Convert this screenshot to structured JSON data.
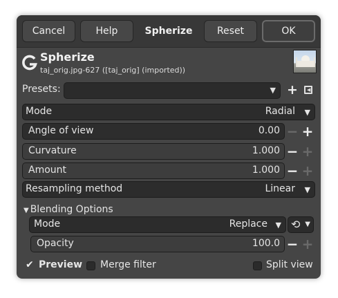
{
  "header": {
    "cancel_label": "Cancel",
    "help_label": "Help",
    "title": "Spherize",
    "reset_label": "Reset",
    "ok_label": "OK"
  },
  "plugin": {
    "logo_letter": "G",
    "title": "Spherize",
    "subtitle": "taj_orig.jpg-627 ([taj_orig] (imported))",
    "thumbnail_icon": "image-thumbnail"
  },
  "presets": {
    "label": "Presets:",
    "value": "",
    "add_icon": "plus-icon",
    "menu_icon": "menu-icon"
  },
  "mode": {
    "label": "Mode",
    "value": "Radial"
  },
  "angle_of_view": {
    "label": "Angle of view",
    "value": "0.00",
    "fill_fraction": 0.0
  },
  "curvature": {
    "label": "Curvature",
    "value": "1.000",
    "fill_fraction": 1.0
  },
  "amount": {
    "label": "Amount",
    "value": "1.000",
    "fill_fraction": 1.0
  },
  "resampling": {
    "label": "Resampling method",
    "value": "Linear"
  },
  "blending": {
    "header": "Blending Options",
    "mode_label": "Mode",
    "mode_value": "Replace",
    "composite_icon": "composite-mode-icon",
    "opacity_label": "Opacity",
    "opacity_value": "100.0",
    "opacity_fill_fraction": 1.0
  },
  "footer": {
    "preview_label": "Preview",
    "preview_checked": true,
    "merge_label": "Merge filter",
    "merge_checked": false,
    "split_label": "Split view",
    "split_checked": false
  },
  "colors": {
    "window_bg": "#454545",
    "header_bg": "#383838",
    "field_bg": "#2c2c2c",
    "field_fill": "#3d3d3d"
  }
}
